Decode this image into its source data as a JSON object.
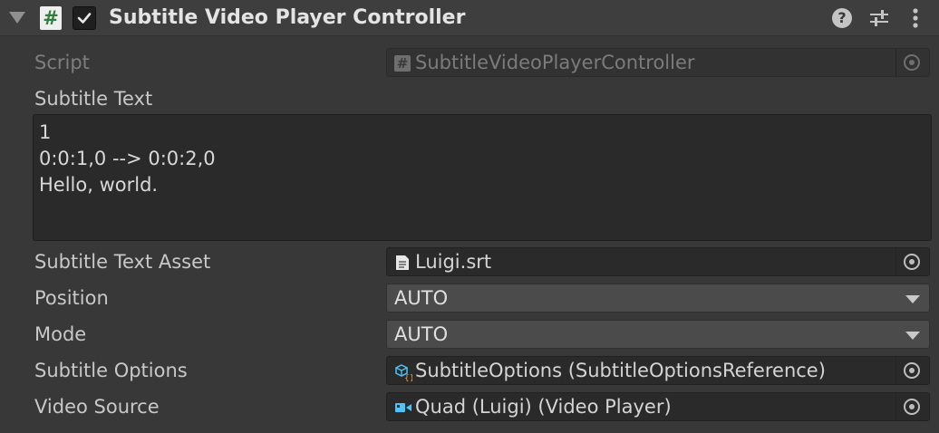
{
  "header": {
    "title": "Subtitle Video Player Controller",
    "script_icon_glyph": "#",
    "enabled": true,
    "help_glyph": "?",
    "icons": [
      "foldout-arrow-icon",
      "script-icon",
      "checkbox-checked-icon",
      "help-icon",
      "settings-sliders-icon",
      "more-vertical-icon"
    ]
  },
  "fields": {
    "script": {
      "label": "Script",
      "icon_glyph": "#",
      "value": "SubtitleVideoPlayerController"
    },
    "subtitle_text": {
      "label": "Subtitle Text",
      "lines": [
        "1",
        "0:0:1,0 --> 0:0:2,0",
        "Hello, world."
      ]
    },
    "subtitle_text_asset": {
      "label": "Subtitle Text Asset",
      "value": "Luigi.srt",
      "icon": "text-file-icon"
    },
    "position": {
      "label": "Position",
      "value": "AUTO"
    },
    "mode": {
      "label": "Mode",
      "value": "AUTO"
    },
    "subtitle_options": {
      "label": "Subtitle Options",
      "value": "SubtitleOptions (SubtitleOptionsReference)",
      "icon": "scriptable-object-icon"
    },
    "video_source": {
      "label": "Video Source",
      "value": "Quad (Luigi) (Video Player)",
      "icon": "video-player-icon"
    }
  },
  "colors": {
    "background": "#383838",
    "header": "#3e3e3e",
    "field": "#2a2a2a",
    "dropdown": "#4b4b4b",
    "script_icon_green": "#2f7f3f",
    "accent_blue": "#4fc3f7",
    "accent_orange": "#e8a33c"
  }
}
